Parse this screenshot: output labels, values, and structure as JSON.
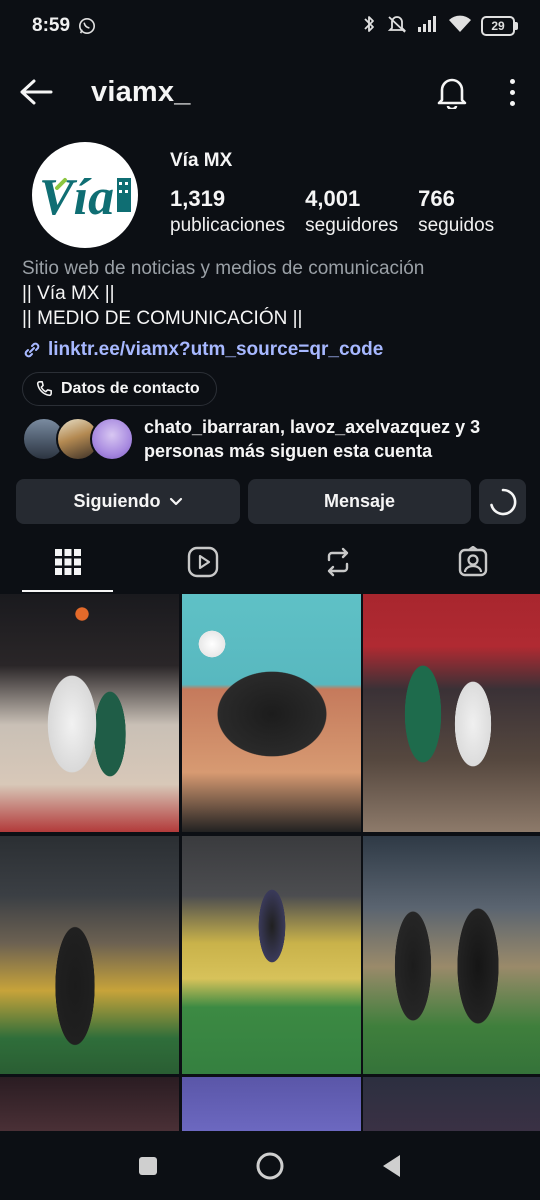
{
  "status": {
    "time": "8:59",
    "battery": "29"
  },
  "header": {
    "username": "viamx_"
  },
  "profile": {
    "display_name": "Vía MX",
    "logo_text": "Vía",
    "stats": [
      {
        "value": "1,319",
        "label": "publicaciones"
      },
      {
        "value": "4,001",
        "label": "seguidores"
      },
      {
        "value": "766",
        "label": "seguidos"
      }
    ],
    "bio": {
      "category": "Sitio web de noticias y medios de comunicación",
      "line1": "|| Vía MX ||",
      "line2": "|| MEDIO DE COMUNICACIÓN ||",
      "link": "linktr.ee/viamx?utm_source=qr_code"
    },
    "contact_label": "Datos de contacto",
    "followed_by": {
      "line1": "chato_ibarraran, lavoz_axelvazquez y 3",
      "line2": "personas más siguen esta cuenta"
    }
  },
  "actions": {
    "following": "Siguiendo",
    "message": "Mensaje"
  },
  "tabs": [
    "grid",
    "reels",
    "reposts",
    "tagged"
  ],
  "posts": [
    {
      "alt": "basketball-jump-ball"
    },
    {
      "alt": "basketball-team-huddle"
    },
    {
      "alt": "basketball-rebound"
    },
    {
      "alt": "soccer-player-stadium"
    },
    {
      "alt": "soccer-handstand-celebration"
    },
    {
      "alt": "soccer-players-celebration"
    },
    {
      "alt": "crowd"
    },
    {
      "alt": "stadium-seats"
    },
    {
      "alt": "crowd-night"
    }
  ],
  "colors": {
    "background": "#0c0f14",
    "button": "#262a31",
    "link": "#a7b8ff",
    "brand_teal": "#0f6e73"
  }
}
